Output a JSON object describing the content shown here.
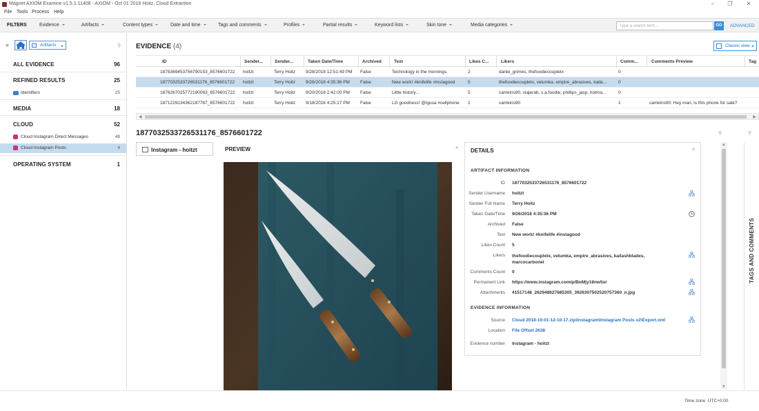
{
  "window": {
    "title": "Magnet AXIOM Examine v1.5.1.11408 - AXIOM - Oct 01 2018 Hoitz, Cloud Extraction",
    "controls": [
      "–",
      "❐",
      "✕"
    ]
  },
  "menu": [
    "File",
    "Tools",
    "Process",
    "Help"
  ],
  "filters": {
    "label": "FILTERS",
    "items": [
      "Evidence",
      "Artifacts",
      "Content types",
      "Date and time",
      "Tags and comments",
      "Profiles",
      "Partial results",
      "Keyword lists",
      "Skin tone",
      "Media categories"
    ],
    "search_placeholder": "Type a search term...",
    "go_label": "GO",
    "advanced_label": "ADVANCED"
  },
  "left": {
    "collapse_icon": "«",
    "artifacts_label": "Artifacts",
    "categories": [
      {
        "label": "ALL EVIDENCE",
        "count": "96"
      },
      {
        "label": "REFINED RESULTS",
        "count": "25"
      },
      {
        "label": "MEDIA",
        "count": "18"
      },
      {
        "label": "CLOUD",
        "count": "52"
      },
      {
        "label": "OPERATING SYSTEM",
        "count": "1"
      }
    ],
    "subitems": [
      {
        "label": "Identifiers",
        "count": "25",
        "color": "#3a7fd0"
      },
      {
        "label": "Cloud Instagram Direct Messages",
        "count": "48",
        "color": "#c13584"
      },
      {
        "label": "Cloud Instagram Posts",
        "count": "4",
        "color": "#c13584"
      }
    ]
  },
  "evidence": {
    "title": "EVIDENCE",
    "count": "(4)",
    "view_label": "Classic view",
    "columns": [
      "ID",
      "Sender...",
      "Sender...",
      "Taken Date/Time",
      "Archived",
      "Text",
      "Likes C...",
      "Likers",
      "Comm...",
      "Comments Preview",
      "Tag"
    ],
    "rows": [
      [
        "1878369453756790153_8576601722",
        "hoitzt",
        "Terry Hoitz",
        "9/28/2018 12:51:49 PM",
        "False",
        "Technology in the mornings.",
        "2",
        "dante_grimes, thefoodiecoupletx",
        "0",
        ""
      ],
      [
        "1877032533726531176_8576601722",
        "hoitzt",
        "Terry Hoitz",
        "9/26/2018 4:35:36 PM",
        "False",
        "New work! #knifelife #instagood",
        "5",
        "thefoodiecoupletx, velumka, empire_abrasives, kaila...",
        "0",
        ""
      ],
      [
        "1876267025772190063_8576601722",
        "hoitzt",
        "Terry Hoitz",
        "9/20/2018 2:42:00 PM",
        "False",
        "Little history...",
        "5",
        "camkins90, viajerab, s.a.foodie, phillips_jasp, hotma...",
        "0",
        ""
      ],
      [
        "1871229134362187787_8576601722",
        "hoitzt",
        "Terry Hoitz",
        "9/18/2018 4:25:17 PM",
        "False",
        "LG goodness! @lgusa #cellphone",
        "1",
        "camkins90",
        "1",
        "camkins90: Hey man, is this phone for sale?"
      ]
    ],
    "selected_row": 1
  },
  "detail": {
    "title": "1877032533726531176_8576601722",
    "source_label": "Instagram - hoitzt",
    "preview_label": "PREVIEW",
    "details_label": "DETAILS",
    "artifact_section": "ARTIFACT INFORMATION",
    "fields": [
      {
        "label": "ID",
        "value": "1877032533726531176_8576601722"
      },
      {
        "label": "Sender Username",
        "value": "hoitzt"
      },
      {
        "label": "Sender Full Name",
        "value": "Terry Hoitz"
      },
      {
        "label": "Taken Date/Time",
        "value": "9/26/2018 4:35:36 PM"
      },
      {
        "label": "Archived",
        "value": "False"
      },
      {
        "label": "Text",
        "value": "New work! #knifelife #instagood"
      },
      {
        "label": "Likes Count",
        "value": "5"
      },
      {
        "label": "Likers",
        "value": "thefoodiecoupletx, velumka, empire_abrasives, kailashblades, marcocarbonel"
      },
      {
        "label": "Comments Count",
        "value": "0"
      },
      {
        "label": "Permanent Link",
        "value": "https://www.instagram.com/p/BoMjy18nw5o/"
      },
      {
        "label": "Attachments",
        "value": "41517148_262948627685305_3926307502520757360_n.jpg"
      }
    ],
    "evidence_section": "EVIDENCE INFORMATION",
    "source_field": {
      "label": "Source",
      "value": "Cloud 2018-10-01-12-10-17.zip\\Instagram\\Instagram Posts v2\\Export.xml"
    },
    "location_field": {
      "label": "Location",
      "value": "File Offset 2638"
    },
    "evnum_field": {
      "label": "Evidence number",
      "value": "Instagram - hoitzt"
    },
    "side_tab": "TAGS AND COMMENTS"
  },
  "status": {
    "timezone_label": "Time zone",
    "timezone_value": "UTC+0:00"
  },
  "colors": {
    "accent": "#3a8fd6",
    "selection": "#c5dcef",
    "link": "#2a6fc4"
  }
}
